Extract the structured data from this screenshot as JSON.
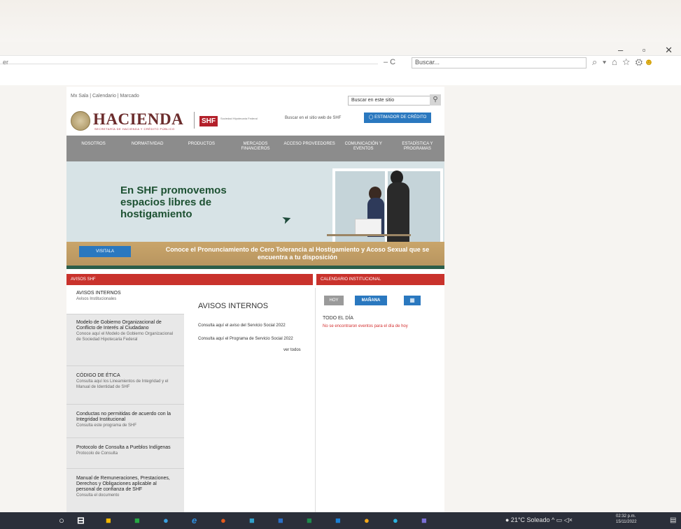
{
  "browser": {
    "window_controls": "– ▫ ✕",
    "address_left": "er",
    "refresh": "– C",
    "search_placeholder": "Buscar...",
    "toolbar_icons": "⌕ ▾  ⌂ ☆ ⚙"
  },
  "site": {
    "topnav": "Mx   Sala   |   Calendario   |   Marcado",
    "search_placeholder": "Buscar en este sitio",
    "search_button": "⚲",
    "logo_text": "HACIENDA",
    "logo_sub": "SECRETARÍA DE HACIENDA Y CRÉDITO PÚBLICO",
    "shf_logo": "SHF",
    "shf_sub": "Sociedad Hipotecaria Federal",
    "search_label": "Buscar en el sitio web de SHF",
    "blue_button": "◯ ESTIMADOR DE CRÉDITO",
    "nav": [
      "NOSOTROS",
      "NORMATIVIDAD",
      "PRODUCTOS",
      "MERCADOS FINANCIEROS",
      "ACCESO PROVEEDORES",
      "COMUNICACIÓN Y EVENTOS",
      "ESTADÍSTICA Y PROGRAMAS"
    ],
    "hero": {
      "title": "En SHF promovemos espacios libres de hostigamiento",
      "button": "VISITALA",
      "message": "Conoce el Pronunciamiento de Cero Tolerancia al Hostigamiento y Acoso Sexual que se encuentra a tu disposición"
    },
    "avisos_bar": "AVISOS SHF",
    "calendar_bar": "CALENDARIO INSTITUCIONAL",
    "sidebar": [
      {
        "title": "AVISOS INTERNOS",
        "sub": "Avisos Institucionales"
      },
      {
        "title": "Modelo de Gobierno Organizacional de Conflicto de Interés al Ciudadano",
        "sub": "Conoce aquí el Modelo de Gobierno Organizacional de Sociedad Hipotecaria Federal"
      },
      {
        "title": "CÓDIGO DE ÉTICA",
        "sub": "Consulta aquí los Lineamientos de Integridad y el Manual de Identidad de SHF"
      },
      {
        "title": "Conductas no permitidas de acuerdo con la Integridad Institucional",
        "sub": "Consulta este programa de SHF"
      },
      {
        "title": "Protocolo de Consulta a Pueblos Indígenas",
        "sub": "Protocolo de Consulta"
      },
      {
        "title": "Manual de Remuneraciones, Prestaciones, Derechos y Obligaciones aplicable al personal de confianza de SHF",
        "sub": "Consulta el documento"
      }
    ],
    "avisos": {
      "title": "AVISOS INTERNOS",
      "line1": "Consulta aquí el aviso del Servicio Social 2022",
      "line2": "Consulta aquí el Programa de Servicio Social 2022",
      "more": "ver todos"
    },
    "calendar": {
      "hoy": "HOY",
      "manana": "MAÑANA",
      "icon": "▦",
      "day": "TODO EL DÍA",
      "note": "No se encontraron eventos para el día de hoy"
    }
  },
  "taskbar": {
    "tray": "● 21°C Soleado  ^  ▭  ◁×",
    "time": "02:32 p.m.",
    "date": "15/11/2022",
    "notif": "▤"
  }
}
